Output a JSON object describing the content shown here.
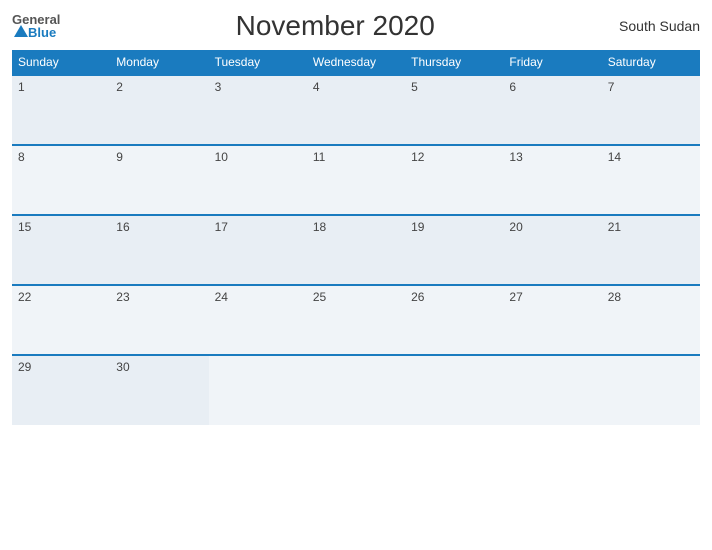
{
  "header": {
    "logo": {
      "general": "General",
      "blue": "Blue",
      "triangle": "▲"
    },
    "title": "November 2020",
    "country": "South Sudan"
  },
  "weekdays": [
    "Sunday",
    "Monday",
    "Tuesday",
    "Wednesday",
    "Thursday",
    "Friday",
    "Saturday"
  ],
  "weeks": [
    [
      1,
      2,
      3,
      4,
      5,
      6,
      7
    ],
    [
      8,
      9,
      10,
      11,
      12,
      13,
      14
    ],
    [
      15,
      16,
      17,
      18,
      19,
      20,
      21
    ],
    [
      22,
      23,
      24,
      25,
      26,
      27,
      28
    ],
    [
      29,
      30,
      null,
      null,
      null,
      null,
      null
    ]
  ]
}
